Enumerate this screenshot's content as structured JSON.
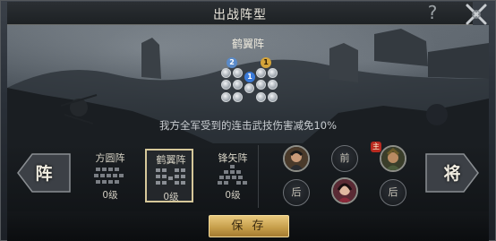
{
  "window": {
    "title": "出战阵型",
    "help_glyph": "?"
  },
  "formation": {
    "name": "鹤翼阵",
    "effect": "我方全军受到的连击武技伤害减免10%",
    "slot_markers": [
      "2",
      "1",
      "1"
    ]
  },
  "nav": {
    "left_label": "阵",
    "right_label": "将"
  },
  "formation_options": [
    {
      "name": "方圆阵",
      "level": "0级",
      "selected": false
    },
    {
      "name": "鹤翼阵",
      "level": "0级",
      "selected": true
    },
    {
      "name": "锋矢阵",
      "level": "0级",
      "selected": false
    }
  ],
  "general_slots": {
    "front_label": "前",
    "back_left_label": "后",
    "back_right_label": "后",
    "main_badge": "主"
  },
  "save_label": "保 存",
  "colors": {
    "accent_gold": "#d6c89a",
    "badge_red": "#b82a20",
    "button_gold": "#c49c48"
  }
}
